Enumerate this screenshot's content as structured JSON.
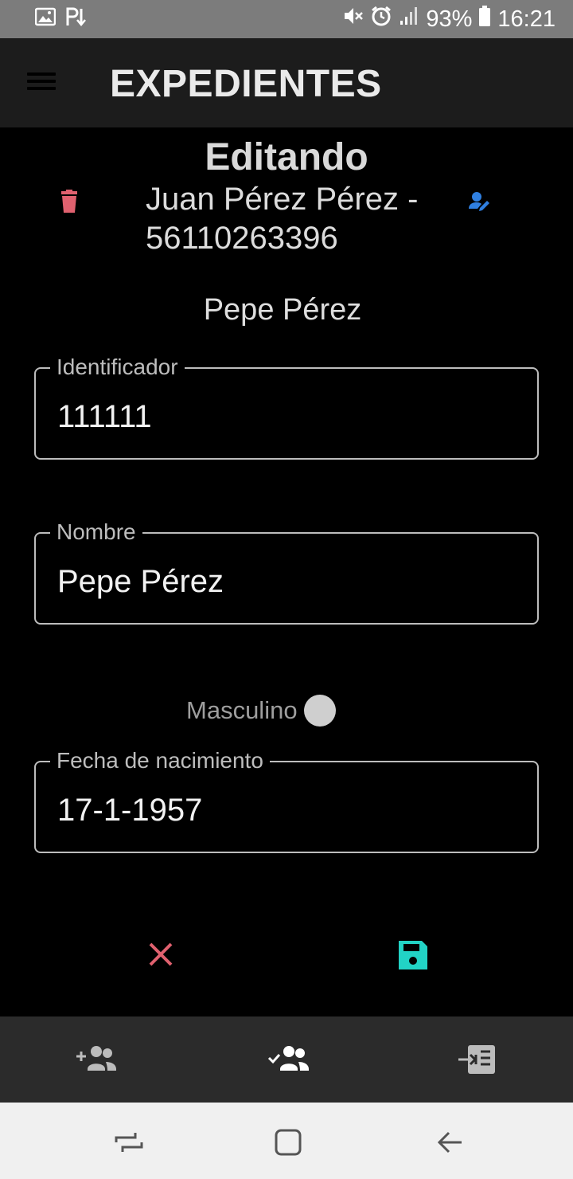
{
  "status_bar": {
    "battery": "93%",
    "time": "16:21",
    "left_icons": [
      "image-icon",
      "p-download-icon"
    ],
    "right_icons": [
      "mute-icon",
      "alarm-icon",
      "signal-icon",
      "battery-icon"
    ]
  },
  "app_bar": {
    "title": "EXPEDIENTES",
    "menu_icon": "hamburger-menu-icon"
  },
  "editor": {
    "heading": "Editando",
    "record_title": "Juan Pérez Pérez  - 56110263396",
    "person_name": "Pepe Pérez"
  },
  "form": {
    "identificador": {
      "label": "Identificador",
      "value": "111111"
    },
    "nombre": {
      "label": "Nombre",
      "value": "Pepe Pérez"
    },
    "gender": {
      "label": "Masculino"
    },
    "fecha": {
      "label": "Fecha de nacimiento",
      "value": "17-1-1957"
    }
  },
  "actions": {
    "cancel_icon": "close-icon",
    "save_icon": "save-icon"
  },
  "bottom_nav": {
    "items": [
      "add-person-icon",
      "people-check-icon",
      "import-icon"
    ]
  },
  "colors": {
    "delete": "#e0616f",
    "edit": "#2f7fe0",
    "cancel": "#e0616f",
    "save": "#22d3c5",
    "app_bar_bg": "#1c1c1c",
    "status_bar_bg": "#7c7c7c",
    "bottom_nav_bg": "#2b2b2b"
  }
}
